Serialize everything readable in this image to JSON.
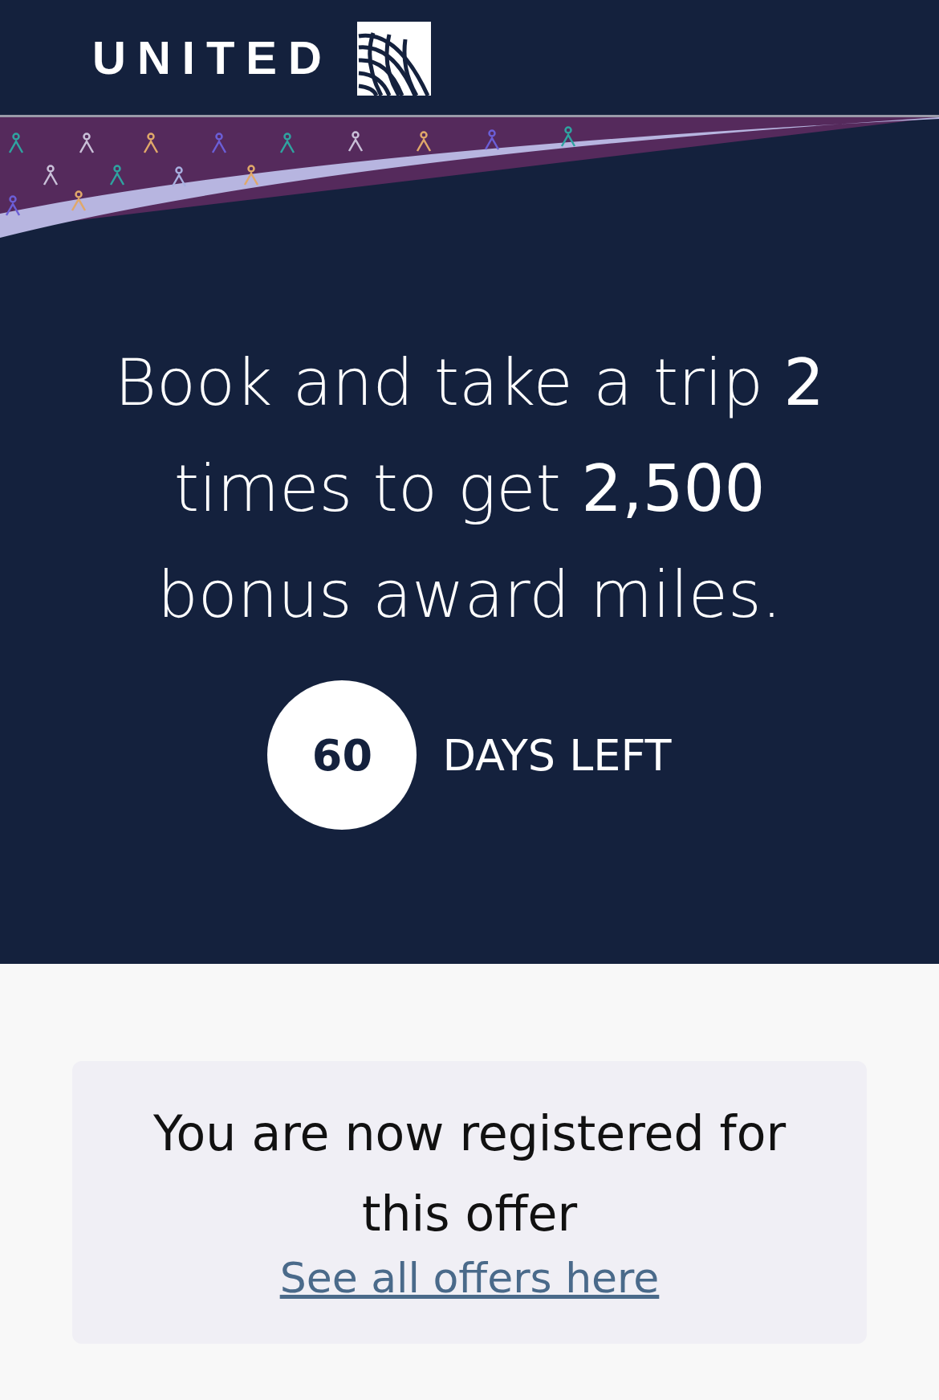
{
  "header": {
    "logo_text": "UNITED"
  },
  "offer": {
    "headline": "Book and take a trip **2** times to get **2,500** bonus award miles.",
    "days": "60",
    "days_label": "DAYS LEFT"
  },
  "registration": {
    "message": "You are now registered for this offer",
    "link": "See all offers here"
  }
}
